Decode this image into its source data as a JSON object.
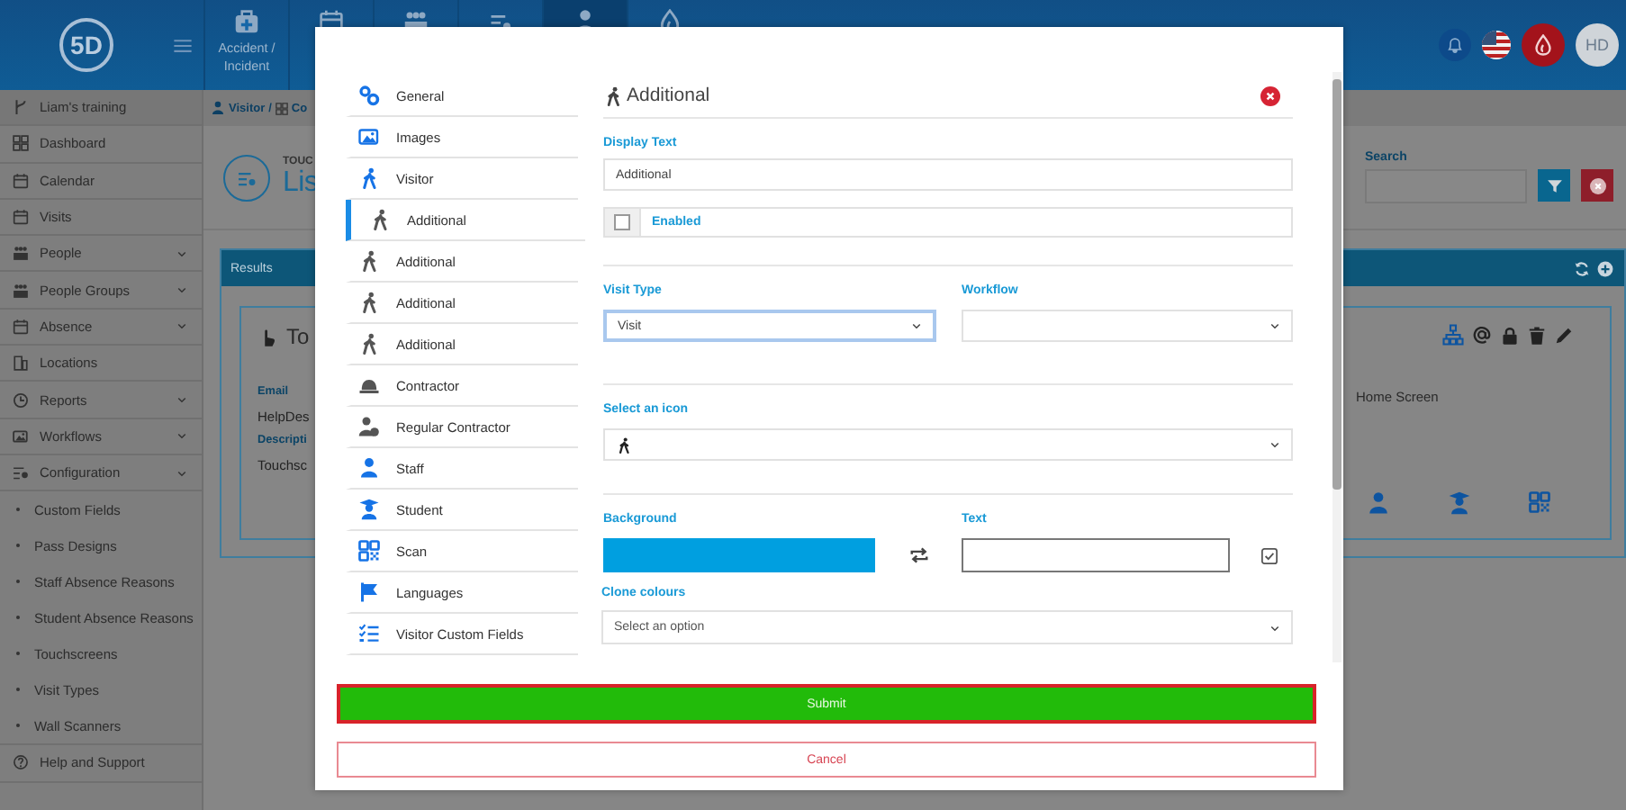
{
  "header": {
    "logo": "5D",
    "tiles": [
      {
        "label": "Accident / Incident",
        "selected": false
      },
      {
        "selected": false
      },
      {
        "selected": false
      },
      {
        "selected": false
      },
      {
        "selected": true
      },
      {
        "selected": false
      }
    ],
    "avatar": "HD"
  },
  "sidebar": {
    "workspace": "Liam's training",
    "items": [
      {
        "label": "Dashboard",
        "expandable": false
      },
      {
        "label": "Calendar",
        "expandable": false
      },
      {
        "label": "Visits",
        "expandable": false
      },
      {
        "label": "People",
        "expandable": true
      },
      {
        "label": "People Groups",
        "expandable": true
      },
      {
        "label": "Absence",
        "expandable": true
      },
      {
        "label": "Locations",
        "expandable": false
      },
      {
        "label": "Reports",
        "expandable": true
      },
      {
        "label": "Workflows",
        "expandable": true
      },
      {
        "label": "Configuration",
        "expandable": true,
        "children": [
          {
            "label": "Custom Fields"
          },
          {
            "label": "Pass Designs"
          },
          {
            "label": "Staff Absence Reasons"
          },
          {
            "label": "Student Absence Reasons"
          },
          {
            "label": "Touchscreens"
          },
          {
            "label": "Visit Types"
          },
          {
            "label": "Wall Scanners"
          }
        ]
      },
      {
        "label": "Help and Support",
        "expandable": false
      }
    ]
  },
  "breadcrumb": [
    "Visitor",
    "/",
    "Co"
  ],
  "page_header": {
    "overline": "TOUC",
    "title": "Lis"
  },
  "search": {
    "label": "Search"
  },
  "results": {
    "title": "Results",
    "card": {
      "title": "To",
      "fields": [
        {
          "label": "Email",
          "value": "HelpDes"
        },
        {
          "label": "Descripti",
          "value": "Touchsc"
        }
      ],
      "home_screen": "Home Screen"
    }
  },
  "modal": {
    "nav": [
      {
        "label": "General",
        "selected": false
      },
      {
        "label": "Images",
        "selected": false
      },
      {
        "label": "Visitor",
        "selected": false
      },
      {
        "label": "Additional",
        "selected": true
      },
      {
        "label": "Additional",
        "selected": false
      },
      {
        "label": "Additional",
        "selected": false
      },
      {
        "label": "Additional",
        "selected": false
      },
      {
        "label": "Contractor",
        "selected": false
      },
      {
        "label": "Regular Contractor",
        "selected": false
      },
      {
        "label": "Staff",
        "selected": false
      },
      {
        "label": "Student",
        "selected": false
      },
      {
        "label": "Scan",
        "selected": false
      },
      {
        "label": "Languages",
        "selected": false
      },
      {
        "label": "Visitor Custom Fields",
        "selected": false
      }
    ],
    "heading": "Additional",
    "display_text": {
      "label": "Display Text",
      "value": "Additional"
    },
    "enabled": {
      "label": "Enabled",
      "checked": false
    },
    "visit_type": {
      "label": "Visit Type",
      "value": "Visit"
    },
    "workflow": {
      "label": "Workflow"
    },
    "icon_select": {
      "label": "Select an icon"
    },
    "background": {
      "label": "Background",
      "color": "#009fe0"
    },
    "text": {
      "label": "Text",
      "color": "#ffffff"
    },
    "clone_colours": {
      "label": "Clone colours",
      "placeholder": "Select an option"
    },
    "submit": "Submit",
    "cancel": "Cancel"
  }
}
